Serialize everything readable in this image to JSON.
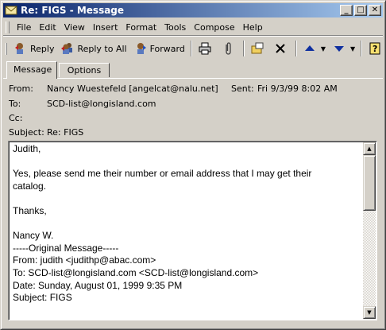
{
  "window": {
    "title": "Re: FIGS - Message",
    "minimize_glyph": "_",
    "maximize_glyph": "□",
    "close_glyph": "✕"
  },
  "menu": [
    "File",
    "Edit",
    "View",
    "Insert",
    "Format",
    "Tools",
    "Compose",
    "Help"
  ],
  "toolbar": {
    "reply": "Reply",
    "reply_all": "Reply to All",
    "forward": "Forward"
  },
  "tabs": [
    "Message",
    "Options"
  ],
  "header": {
    "from_label": "From:",
    "from_value": "Nancy Wuestefeld [angelcat@nalu.net]",
    "sent_label": "Sent:",
    "sent_value": "Fri 9/3/99 8:02 AM",
    "to_label": "To:",
    "to_value": "SCD-list@longisland.com",
    "cc_label": "Cc:",
    "cc_value": "",
    "subject_label": "Subject:",
    "subject_value": "Re: FIGS"
  },
  "body": {
    "lines": [
      "Judith,",
      "",
      "Yes, please send me their number or email address that I may get their",
      "catalog.",
      "",
      "Thanks,",
      "",
      "Nancy W.",
      "-----Original Message-----",
      "From: judith <judithp@abac.com>",
      "To: SCD-list@longisland.com <SCD-list@longisland.com>",
      "Date: Sunday, August 01, 1999 9:35 PM",
      "Subject: FIGS"
    ]
  },
  "colors": {
    "title_gradient_start": "#0a246a",
    "title_gradient_end": "#a6caf0",
    "face": "#d4d0c8"
  },
  "icons": [
    "envelope-icon",
    "reply-icon",
    "reply-all-icon",
    "forward-icon",
    "print-icon",
    "attach-icon",
    "move-to-folder-icon",
    "delete-icon",
    "previous-icon",
    "next-icon",
    "address-book-icon"
  ]
}
